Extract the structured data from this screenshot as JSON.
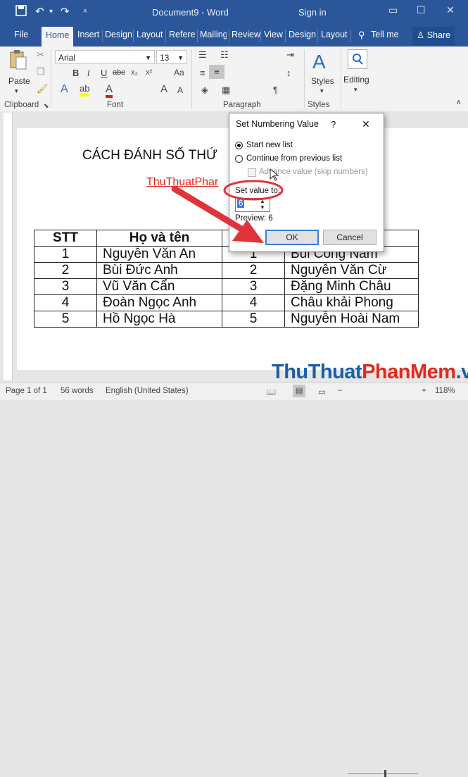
{
  "window": {
    "document_title": "Document9 - Word",
    "sign_in": "Sign in",
    "save_icon": "save-icon",
    "undo_icon": "undo-icon",
    "redo_icon": "redo-icon",
    "customize_icon": "customize-icon"
  },
  "tabs": [
    "File",
    "Home",
    "Insert",
    "Design",
    "Layout",
    "Referer",
    "Mailing",
    "Review",
    "View",
    "Design",
    "Layout",
    "Tell me",
    "Share"
  ],
  "ribbon": {
    "clipboard": {
      "paste": "Paste",
      "group": "Clipboard"
    },
    "font": {
      "name": "Arial",
      "size": "13",
      "group": "Font"
    },
    "paragraph": {
      "group": "Paragraph"
    },
    "styles": {
      "label": "Styles",
      "group": "Styles"
    },
    "editing": {
      "label": "Editing"
    }
  },
  "document": {
    "heading": "CÁCH ĐÁNH SỐ THỨ",
    "subheading": "ThuThuatPhar",
    "table": {
      "headers": [
        "STT",
        "Họ và tên",
        "",
        ""
      ],
      "rows": [
        [
          "1",
          "Nguyễn Văn An",
          "1",
          "Bùi Công Nam"
        ],
        [
          "2",
          "Bùi Đức Anh",
          "2",
          "Nguyễn Văn Cừ"
        ],
        [
          "3",
          "Vũ Văn Cẩn",
          "3",
          "Đặng Minh Châu"
        ],
        [
          "4",
          "Đoàn Ngọc Anh",
          "4",
          "Châu khải Phong"
        ],
        [
          "5",
          "Hồ Ngọc Hà",
          "5",
          "Nguyễn Hoài Nam"
        ]
      ]
    }
  },
  "dialog": {
    "title": "Set Numbering Value",
    "help": "?",
    "close": "✕",
    "option_start": "Start new list",
    "option_continue": "Continue from previous list",
    "advance": "Advance value (skip numbers)",
    "set_value_label": "Set value to:",
    "set_value": "6",
    "preview": "Preview: 6",
    "ok": "OK",
    "cancel": "Cancel",
    "selected_option": "Start new list"
  },
  "status": {
    "page": "Page 1 of 1",
    "words": "56 words",
    "language": "English (United States)",
    "zoom": "118%"
  },
  "watermark": {
    "part1": "ThuThuat",
    "part2": "PhanMem",
    "part3": ".vn"
  },
  "colors": {
    "accent": "#2b579a",
    "annotation_red": "#e0343a",
    "watermark_blue": "#1b5fa8",
    "watermark_red": "#e12a1f"
  }
}
